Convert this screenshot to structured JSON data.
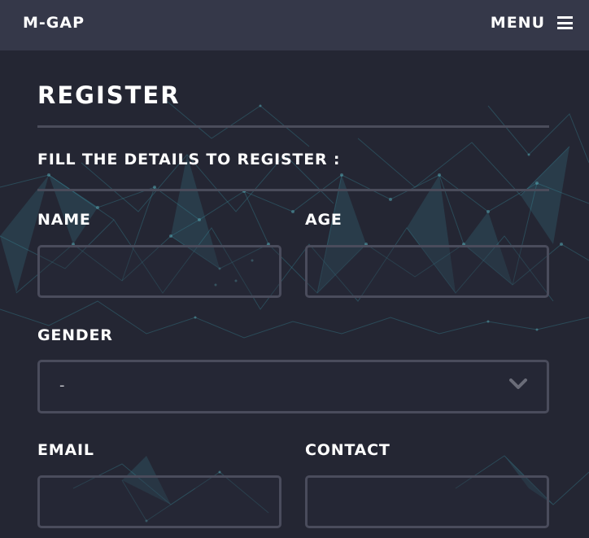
{
  "navbar": {
    "brand": "M-GAP",
    "menu_label": "MENU",
    "menu_icon": "hamburger-icon"
  },
  "form": {
    "title": "REGISTER",
    "subtitle": "FILL THE DETAILS TO REGISTER :",
    "fields": {
      "name": {
        "label": "NAME",
        "value": "",
        "placeholder": ""
      },
      "age": {
        "label": "AGE",
        "value": "",
        "placeholder": ""
      },
      "gender": {
        "label": "GENDER",
        "selected": "-",
        "icon": "chevron-down-icon"
      },
      "email": {
        "label": "EMAIL",
        "value": "",
        "placeholder": ""
      },
      "contact": {
        "label": "CONTACT",
        "value": "",
        "placeholder": ""
      }
    }
  },
  "colors": {
    "background": "#242633",
    "navbar": "#353849",
    "divider": "#4a4c5b",
    "input_border": "#4a4c5c",
    "network_accent": "#3a8f9e",
    "text": "#ffffff"
  }
}
